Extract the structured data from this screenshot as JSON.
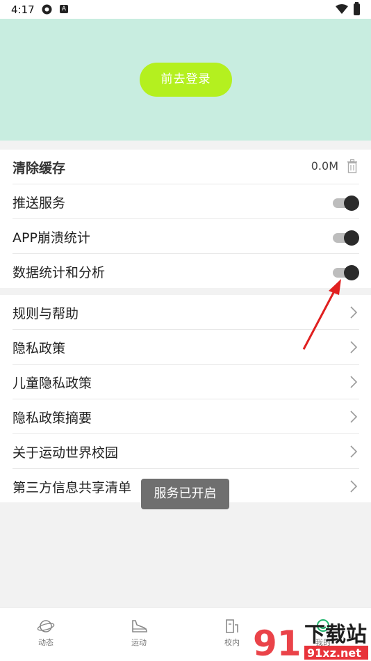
{
  "status_bar": {
    "time": "4:17",
    "icon_a_letter": "A"
  },
  "header": {
    "login_button": "前去登录",
    "bg_color": "#c8ede0",
    "button_color": "#b4f01f"
  },
  "settings": {
    "clear_cache": {
      "label": "清除缓存",
      "value": "0.0M"
    },
    "push_service": {
      "label": "推送服务",
      "enabled": true
    },
    "crash_stats": {
      "label": "APP崩溃统计",
      "enabled": true
    },
    "data_analysis": {
      "label": "数据统计和分析",
      "enabled": true
    }
  },
  "links": [
    {
      "label": "规则与帮助"
    },
    {
      "label": "隐私政策"
    },
    {
      "label": "儿童隐私政策"
    },
    {
      "label": "隐私政策摘要"
    },
    {
      "label": "关于运动世界校园"
    },
    {
      "label": "第三方信息共享清单"
    }
  ],
  "toast": {
    "text": "服务已开启"
  },
  "bottom_nav": [
    {
      "label": "动态",
      "icon": "planet-icon"
    },
    {
      "label": "运动",
      "icon": "shoe-icon"
    },
    {
      "label": "校内",
      "icon": "campus-icon"
    },
    {
      "label": "我的",
      "icon": "profile-icon"
    }
  ],
  "watermark": {
    "line1": "下载站",
    "line2": "91xz.net",
    "logo_digits": "91"
  },
  "accent_colors": {
    "arrow": "#e02020",
    "toggle_thumb": "#2b2b2b"
  }
}
